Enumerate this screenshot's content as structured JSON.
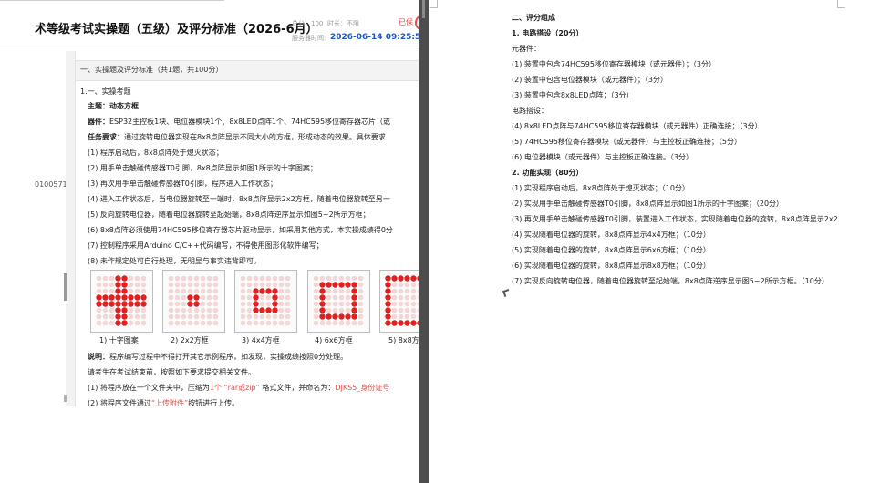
{
  "left": {
    "title": "术等级考试实操题（五级）及评分标准（2026-6月）",
    "score_label": "总分：100",
    "duration_label": "时长：不限",
    "server_time_label": "服务器时间:",
    "server_time": "2026-06-14 09:25:52",
    "submitted_label": "已保",
    "side_id": "0100571",
    "section_header": "一、实操题及评分标准（共1题，共100分）",
    "q_number": "1.一、实操考题",
    "theme_label": "主题：",
    "theme_value": "动态方框",
    "device_label": "器件：",
    "device_value": "ESP32主控板1块、电位器模块1个、8x8LED点阵1个、74HC595移位寄存器芯片（或",
    "task_label": "任务要求：",
    "task_value": "通过旋转电位器实现在8x8点阵显示不同大小的方框，形成动态的效果。具体要求",
    "requirements": [
      "(1) 程序启动后，8x8点阵处于熄灭状态；",
      "(2) 用手单击触碰传感器T0引脚，8x8点阵显示如图1所示的十字图案；",
      "(3) 再次用手单击触碰传感器T0引脚，程序进入工作状态；",
      "(4) 进入工作状态后，当电位器旋转至一端时，8x8点阵显示2x2方框，随着电位器旋转至另一",
      "(5) 反向旋转电位器，随着电位器旋转至起始端，8x8点阵逆序显示如图5~2所示方框；",
      "(6) 8x8点阵必须使用74HC595移位寄存器芯片驱动显示，如采用其他方式，本实操成绩得0分",
      "(7) 控制程序采用Arduino C/C++代码编写，不得使用图形化软件编写；",
      "(8) 未作规定处可自行处理，无明显与事实违背即可。"
    ],
    "captions": [
      "1) 十字图案",
      "2) 2x2方框",
      "3) 4x4方框",
      "4) 6x6方框",
      "5) 8x8方"
    ],
    "note_label": "说明：",
    "note_value": "程序编写过程中不得打开其它示例程序，如发现，实操成绩按照0分处理。",
    "submit_intro": "请考生在考试结束前，按照如下要求提交相关文件。",
    "submit1_a": "(1) 将程序放在一个文件夹中，压缩为",
    "submit1_b": "1个 “rar或zip” ",
    "submit1_c": "格式文件，并命名为：",
    "submit1_d": "DJKS5_身份证号",
    "submit2_a": "(2) 将程序文件通过",
    "submit2_b": "“上传附件”",
    "submit2_c": "按钮进行上传。",
    "colors": {
      "accent": "#1a55c8",
      "red": "#d9534f",
      "led": "#e02020",
      "led_off": "#f3d6d6"
    }
  },
  "right": {
    "lines": [
      {
        "text": "二、评分组成",
        "bold": true
      },
      {
        "text": "1. 电路搭设（20分）",
        "bold": true
      },
      {
        "text": "元器件：",
        "bold": false
      },
      {
        "text": "(1) 装置中包含74HC595移位寄存器模块（或元器件）；（3分）",
        "bold": false
      },
      {
        "text": "(2) 装置中包含电位器模块（或元器件）；（3分）",
        "bold": false
      },
      {
        "text": "(3) 装置中包含8x8LED点阵；（3分）",
        "bold": false
      },
      {
        "text": "电路搭设：",
        "bold": false
      },
      {
        "text": "(4) 8x8LED点阵与74HC595移位寄存器模块（或元器件）正确连接；（3分）",
        "bold": false
      },
      {
        "text": "(5) 74HC595移位寄存器模块（或元器件）与主控板正确连接；（5分）",
        "bold": false
      },
      {
        "text": "(6) 电位器模块（或元器件）与主控板正确连接。（3分）",
        "bold": false
      },
      {
        "text": "2. 功能实现（80分）",
        "bold": true
      },
      {
        "text": "(1) 实现程序启动后，8x8点阵处于熄灭状态；（10分）",
        "bold": false
      },
      {
        "text": "(2) 实现用手单击触碰传感器T0引脚，8x8点阵显示如图1所示的十字图案；（20分）",
        "bold": false
      },
      {
        "text": "(3) 再次用手单击触碰传感器T0引脚，装置进入工作状态，实现随着电位器的旋转，8x8点阵显示2x2",
        "bold": false
      },
      {
        "text": "(4) 实现随着电位器的旋转，8x8点阵显示4x4方框；（10分）",
        "bold": false
      },
      {
        "text": "(5) 实现随着电位器的旋转，8x8点阵显示6x6方框；（10分）",
        "bold": false
      },
      {
        "text": "(6) 实现随着电位器的旋转，8x8点阵显示8x8方框；（10分）",
        "bold": false
      },
      {
        "text": "(7) 实现反向旋转电位器，随着电位器旋转至起始端，8x8点阵逆序显示图5~2所示方框。（10分）",
        "bold": false
      }
    ]
  }
}
